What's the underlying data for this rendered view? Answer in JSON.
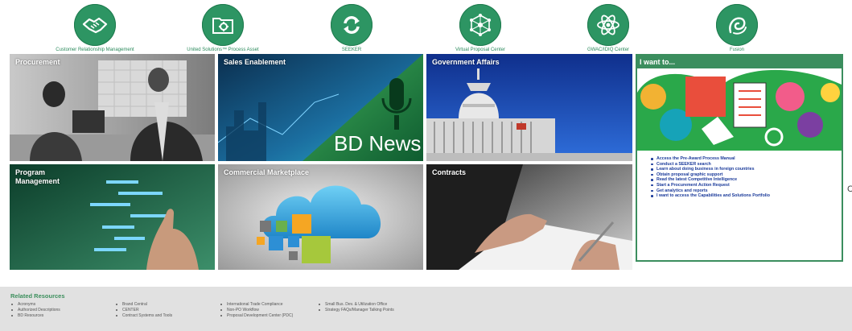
{
  "top_icons": [
    {
      "name": "handshake-icon",
      "label": "Customer Relationship Management"
    },
    {
      "name": "folder-gear-icon",
      "label": "United Solutions™ Process Asset"
    },
    {
      "name": "refresh-arrows-icon",
      "label": "SEEKER"
    },
    {
      "name": "network-nodes-icon",
      "label": "Virtual Proposal Center"
    },
    {
      "name": "atom-icon",
      "label": "GWAC/IDIQ Center"
    },
    {
      "name": "fusion-swirl-icon",
      "label": "Fusion"
    }
  ],
  "tiles": {
    "procurement": "Procurement",
    "sales": "Sales Enablement",
    "bd_news": "BD News",
    "government": "Government Affairs",
    "program": "Program\nManagement",
    "commercial": "Commercial Marketplace",
    "contracts": "Contracts"
  },
  "i_want_to": {
    "title": "I want to...",
    "items": [
      "Access the Pre-Award Process Manual",
      "Conduct a SEEKER search",
      "Learn about doing business in foreign countries",
      "Obtain proposal graphic support",
      "Read the latest Competitive Intelligence",
      "Start a Procurement Action Request",
      "Get analytics and reports",
      "I want to access the Capabilities and Solutions Portfolio"
    ]
  },
  "footer": {
    "title": "Related Resources",
    "columns": [
      [
        "Acronyms",
        "Authorized Descriptions",
        "BD Resources"
      ],
      [
        "Brand Central",
        "CENTER",
        "Contract Systems and Tools"
      ],
      [
        "International Trade Compliance",
        "Non-PO Workflow",
        "Proposal Development Center (PDC)"
      ],
      [
        "Small Bus. Dev. & Utilization Office",
        "Strategy FAQs/Manager Talking Points"
      ]
    ]
  },
  "edge_glyph": "C",
  "colors": {
    "brand_green": "#2d9563",
    "header_green": "#3b8e5e",
    "link_blue": "#1a3a9a",
    "footer_bg": "#e1e1e1"
  }
}
